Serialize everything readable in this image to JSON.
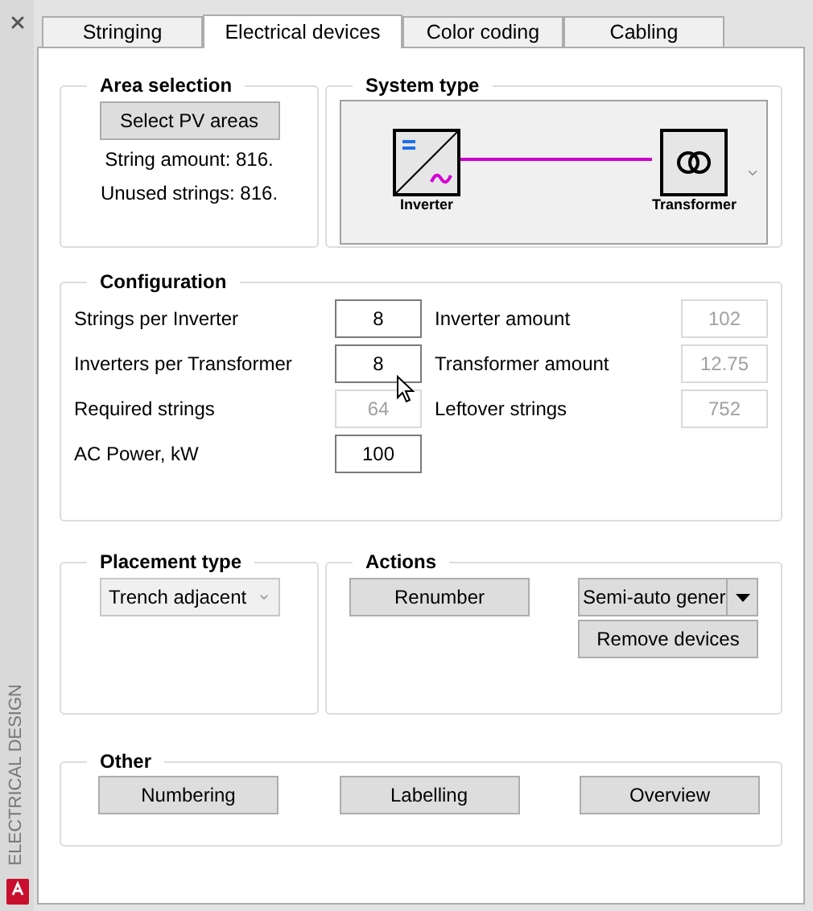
{
  "sidebar": {
    "title": "ELECTRICAL DESIGN"
  },
  "tabs": [
    {
      "label": "Stringing",
      "selected": false
    },
    {
      "label": "Electrical devices",
      "selected": true
    },
    {
      "label": "Color coding",
      "selected": false
    },
    {
      "label": "Cabling",
      "selected": false
    }
  ],
  "area_selection": {
    "title": "Area selection",
    "button": "Select PV areas",
    "lines": [
      "String amount: 816.",
      "Unused strings: 816."
    ]
  },
  "system_type": {
    "title": "System type",
    "nodes": [
      {
        "kind": "inverter",
        "label": "Inverter"
      },
      {
        "kind": "transformer",
        "label": "Transformer"
      }
    ]
  },
  "configuration": {
    "title": "Configuration",
    "fields": [
      {
        "label": "Strings per Inverter",
        "value": "8",
        "disabled": false
      },
      {
        "label": "Inverter amount",
        "value": "102",
        "disabled": true
      },
      {
        "label": "Inverters per Transformer",
        "value": "8",
        "disabled": false
      },
      {
        "label": "Transformer amount",
        "value": "12.75",
        "disabled": true
      },
      {
        "label": "Required strings",
        "value": "64",
        "disabled": true
      },
      {
        "label": "Leftover strings",
        "value": "752",
        "disabled": true
      },
      {
        "label": "AC Power, kW",
        "value": "100",
        "disabled": false
      }
    ]
  },
  "placement_type": {
    "title": "Placement type",
    "dropdown": "Trench adjacent"
  },
  "actions": {
    "title": "Actions",
    "button": "Renumber",
    "split_button": "Semi-auto gener",
    "remove_button": "Remove devices"
  },
  "other": {
    "title": "Other",
    "buttons": [
      "Numbering",
      "Labelling",
      "Overview"
    ]
  }
}
